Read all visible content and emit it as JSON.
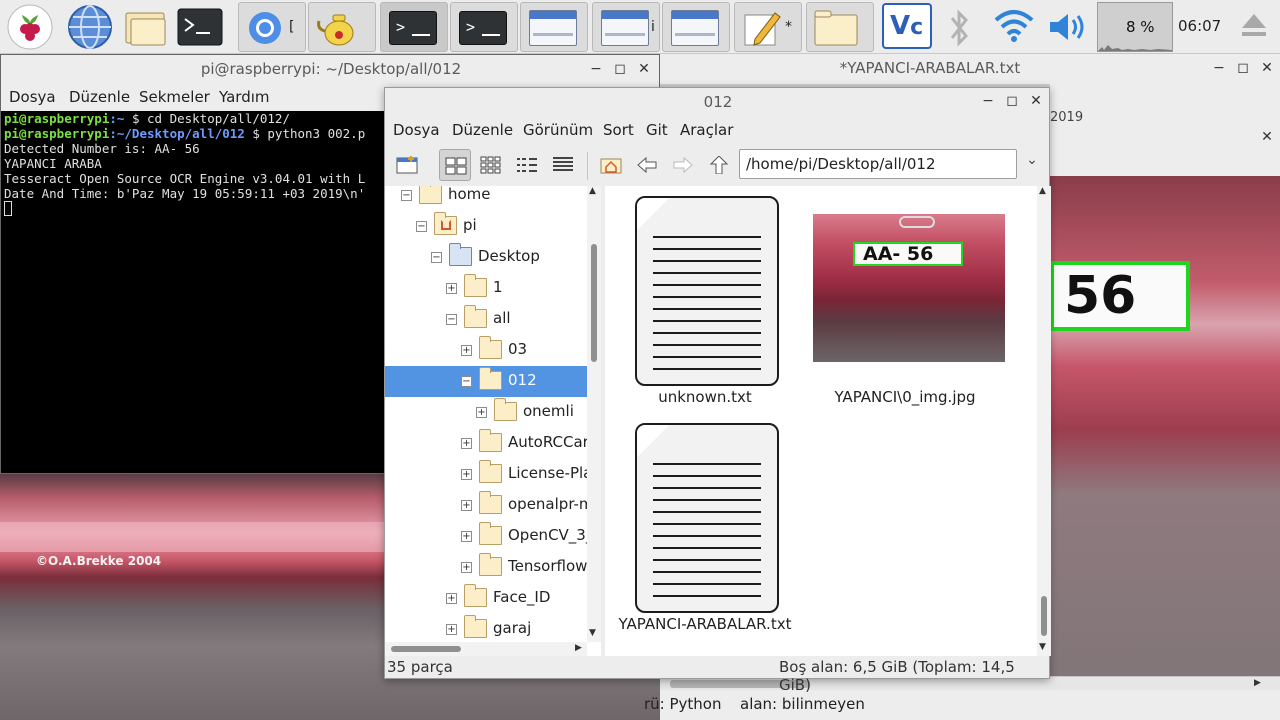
{
  "taskbar": {
    "tasks": [
      {
        "label": "[",
        "icon": "chromium-icon"
      },
      {
        "label": "",
        "icon": "teapot-icon"
      },
      {
        "label": "",
        "icon": "terminal-icon"
      },
      {
        "label": "",
        "icon": "terminal-icon"
      },
      {
        "label": "",
        "icon": "window-icon"
      },
      {
        "label": "i",
        "icon": "window-icon"
      },
      {
        "label": "",
        "icon": "window-icon"
      },
      {
        "label": "*",
        "icon": "text-editor-icon"
      },
      {
        "label": "",
        "icon": "folder-icon"
      }
    ],
    "cpu_percent": "8 %",
    "clock": "06:07"
  },
  "terminal": {
    "title": "pi@raspberrypi: ~/Desktop/all/012",
    "menu": [
      "Dosya",
      "Düzenle",
      "Sekmeler",
      "Yardım"
    ],
    "lines": [
      {
        "user": "pi@raspberrypi",
        "path": ":~",
        "cmd": " $ cd Desktop/all/012/"
      },
      {
        "user": "pi@raspberrypi",
        "path": ":~/Desktop/all/012",
        "cmd": " $ python3 002.p"
      }
    ],
    "output": [
      "Detected Number is: AA- 56",
      "YAPANCI ARABA",
      "Tesseract Open Source OCR Engine v3.04.01 with L",
      "Date And Time: b'Paz May 19 05:59:11 +03 2019\\n'"
    ]
  },
  "photo_watermark": "©O.A.Brekke 2004",
  "editor": {
    "title": "*YAPANCI-ARABALAR.txt",
    "top_text": "2019",
    "plate_text": "56",
    "status_lang": "rü: Python",
    "status_encoding": "alan: bilinmeyen"
  },
  "file_manager": {
    "title": "012",
    "menu": [
      "Dosya",
      "Düzenle",
      "Görünüm",
      "Sort",
      "Git",
      "Araçlar"
    ],
    "path": "/home/pi/Desktop/all/012",
    "tree": [
      {
        "label": "home",
        "expander": "−",
        "level": 0,
        "kind": "folder"
      },
      {
        "label": "pi",
        "expander": "−",
        "level": 1,
        "kind": "home"
      },
      {
        "label": "Desktop",
        "expander": "−",
        "level": 2,
        "kind": "desktop"
      },
      {
        "label": "1",
        "expander": "+",
        "level": 3,
        "kind": "folder"
      },
      {
        "label": "all",
        "expander": "−",
        "level": 3,
        "kind": "folder"
      },
      {
        "label": "03",
        "expander": "+",
        "level": 4,
        "kind": "folder"
      },
      {
        "label": "012",
        "expander": "−",
        "level": 4,
        "kind": "folder",
        "selected": true
      },
      {
        "label": "onemli",
        "expander": "+",
        "level": 5,
        "kind": "folder"
      },
      {
        "label": "AutoRCCar-",
        "expander": "+",
        "level": 4,
        "kind": "folder"
      },
      {
        "label": "License-Pla",
        "expander": "+",
        "level": 4,
        "kind": "folder"
      },
      {
        "label": "openalpr-m",
        "expander": "+",
        "level": 4,
        "kind": "folder"
      },
      {
        "label": "OpenCV_3_",
        "expander": "+",
        "level": 4,
        "kind": "folder"
      },
      {
        "label": "Tensorflow-",
        "expander": "+",
        "level": 4,
        "kind": "folder"
      },
      {
        "label": "Face_ID",
        "expander": "+",
        "level": 3,
        "kind": "folder"
      },
      {
        "label": "garaj",
        "expander": "+",
        "level": 3,
        "kind": "folder"
      }
    ],
    "files": [
      {
        "name": "unknown.txt",
        "kind": "text"
      },
      {
        "name": "YAPANCI\\0_img.jpg",
        "kind": "image",
        "plate_text": "AA- 56"
      },
      {
        "name": "YAPANCI-ARABALAR.txt",
        "kind": "text"
      }
    ],
    "status_count": "35 parça",
    "status_free": "Boş alan: 6,5 GiB (Toplam: 14,5 GiB)"
  },
  "colors": {
    "selection": "#5294e2",
    "terminal_user": "#7be040",
    "terminal_path": "#6f9cff",
    "plate_border": "#21d721"
  }
}
